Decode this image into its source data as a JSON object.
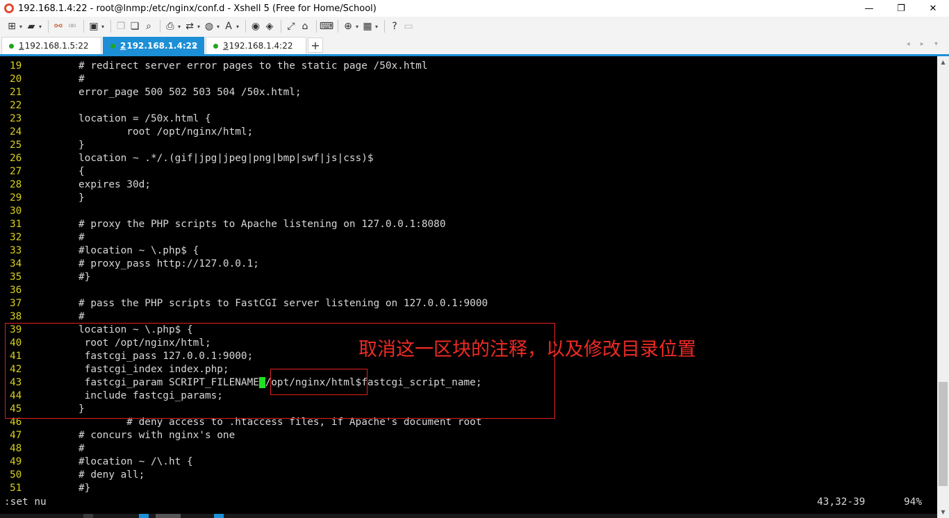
{
  "window": {
    "title": "192.168.1.4:22 - root@lnmp:/etc/nginx/conf.d - Xshell 5 (Free for Home/School)",
    "minimize": "—",
    "maximize": "❐",
    "close": "✕"
  },
  "toolbar": {
    "icons": [
      "new-session-icon",
      "open-folder-icon",
      "reconnect-icon",
      "disconnect-icon",
      "properties-icon",
      "copy-icon",
      "paste-icon",
      "find-icon",
      "print-icon",
      "transfer-icon",
      "globe-icon",
      "font-icon",
      "xftp-icon",
      "xmanager-icon",
      "fullscreen-icon",
      "lock-icon",
      "keyboard-icon",
      "add-icon",
      "layout-icon",
      "help-icon",
      "chat-icon"
    ]
  },
  "tabs": [
    {
      "num": "1",
      "label": " 192.168.1.5:22",
      "active": false
    },
    {
      "num": "2",
      "label": " 192.168.1.4:22",
      "active": true
    },
    {
      "num": "3",
      "label": " 192.168.1.4:22",
      "active": false
    }
  ],
  "tab_close": "×",
  "tab_add": "+",
  "tab_nav": "◂ ▸ ▾",
  "terminal": {
    "lines": [
      {
        "n": "19",
        "text": "# redirect server error pages to the static page /50x.html"
      },
      {
        "n": "20",
        "text": "#"
      },
      {
        "n": "21",
        "text": "error_page 500 502 503 504 /50x.html;"
      },
      {
        "n": "22",
        "text": ""
      },
      {
        "n": "23",
        "text": "location = /50x.html {"
      },
      {
        "n": "24",
        "text": "        root /opt/nginx/html;"
      },
      {
        "n": "25",
        "text": "}"
      },
      {
        "n": "26",
        "text": "location ~ .*/.(gif|jpg|jpeg|png|bmp|swf|js|css)$"
      },
      {
        "n": "27",
        "text": "{"
      },
      {
        "n": "28",
        "text": "expires 30d;"
      },
      {
        "n": "29",
        "text": "}"
      },
      {
        "n": "30",
        "text": ""
      },
      {
        "n": "31",
        "text": "# proxy the PHP scripts to Apache listening on 127.0.0.1:8080"
      },
      {
        "n": "32",
        "text": "#"
      },
      {
        "n": "33",
        "text": "#location ~ \\.php$ {"
      },
      {
        "n": "34",
        "text": "# proxy_pass http://127.0.0.1;"
      },
      {
        "n": "35",
        "text": "#}"
      },
      {
        "n": "36",
        "text": ""
      },
      {
        "n": "37",
        "text": "# pass the PHP scripts to FastCGI server listening on 127.0.0.1:9000"
      },
      {
        "n": "38",
        "text": "#"
      },
      {
        "n": "39",
        "text": "location ~ \\.php$ {"
      },
      {
        "n": "40",
        "text": " root /opt/nginx/html;"
      },
      {
        "n": "41",
        "text": " fastcgi_pass 127.0.0.1:9000;"
      },
      {
        "n": "42",
        "text": " fastcgi_index index.php;"
      },
      {
        "n": "43",
        "text": " fastcgi_param SCRIPT_FILENAME /opt/nginx/html$fastcgi_script_name;"
      },
      {
        "n": "44",
        "text": " include fastcgi_params;"
      },
      {
        "n": "45",
        "text": "}"
      },
      {
        "n": "46",
        "text": "        # deny access to .htaccess files, if Apache's document root"
      },
      {
        "n": "47",
        "text": "# concurs with nginx's one"
      },
      {
        "n": "48",
        "text": "#"
      },
      {
        "n": "49",
        "text": "#location ~ /\\.ht {"
      },
      {
        "n": "50",
        "text": "# deny all;"
      },
      {
        "n": "51",
        "text": "#}"
      }
    ],
    "line43_pre": " fastcgi_param SCRIPT_FILENAME",
    "line43_cursor": " ",
    "line43_post": "/opt/nginx/html$fastcgi_script_name;",
    "command_line": ":set nu",
    "cursor_position": "43,32-39",
    "scroll_percent": "94%"
  },
  "annotation": "取消这一区块的注释，以及修改目录位置",
  "colors": {
    "terminal_bg": "#000000",
    "line_number": "#d8d01c",
    "text": "#d8d8d8",
    "cursor": "#21e021",
    "annotation": "#ee2a24",
    "tab_active": "#1c8fd6"
  },
  "scrollbar": {
    "position": 0.94
  }
}
